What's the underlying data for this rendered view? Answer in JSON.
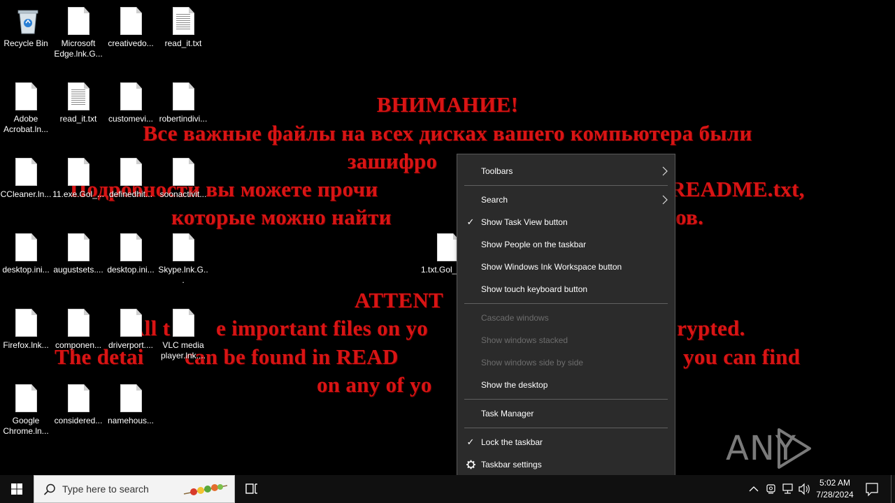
{
  "wallpaper": {
    "lines": [
      "ВНИМАНИЕ!",
      "Все важные файлы на всех дисках вашего компьютера были",
      "зашифро",
      "Подробности вы можете прочи",
      "README.txt,",
      "которые можно найти",
      "ов.",
      "ATTENT",
      "All t",
      "e important files on yo",
      "rypted.",
      "The detai",
      "can be found in READ",
      "you can find",
      "on any of yo"
    ]
  },
  "desktop_icons": [
    {
      "label": "Recycle Bin",
      "icon": "recycle-bin-icon"
    },
    {
      "label": "Microsoft Edge.lnk.G...",
      "icon": "file-icon"
    },
    {
      "label": "creativedo...",
      "icon": "file-icon"
    },
    {
      "label": "read_it.txt",
      "icon": "text-file-icon"
    },
    {
      "label": "Adobe Acrobat.ln...",
      "icon": "file-icon"
    },
    {
      "label": "read_it.txt",
      "icon": "text-file-icon"
    },
    {
      "label": "customevi...",
      "icon": "file-icon"
    },
    {
      "label": "robertindivi...",
      "icon": "file-icon"
    },
    {
      "label": "CCleaner.ln...",
      "icon": "file-icon"
    },
    {
      "label": "11.exe.Gol_...",
      "icon": "file-icon"
    },
    {
      "label": "definedhit...",
      "icon": "file-icon"
    },
    {
      "label": "soonactivit...",
      "icon": "file-icon"
    },
    {
      "label": "desktop.ini...",
      "icon": "file-icon"
    },
    {
      "label": "augustsets....",
      "icon": "file-icon"
    },
    {
      "label": "desktop.ini...",
      "icon": "file-icon"
    },
    {
      "label": "Skype.lnk.G...",
      "icon": "file-icon"
    },
    {
      "label": "Firefox.lnk...",
      "icon": "file-icon"
    },
    {
      "label": "componen...",
      "icon": "file-icon"
    },
    {
      "label": "driverport....",
      "icon": "file-icon"
    },
    {
      "label": "VLC media player.lnk....",
      "icon": "file-icon"
    },
    {
      "label": "Google Chrome.ln...",
      "icon": "file-icon"
    },
    {
      "label": "considered...",
      "icon": "file-icon"
    },
    {
      "label": "namehous...",
      "icon": "file-icon"
    },
    {
      "label": "1.txt.Gol_",
      "icon": "file-icon"
    }
  ],
  "context_menu": {
    "toolbars": "Toolbars",
    "search": "Search",
    "show_task_view": "Show Task View button",
    "show_people": "Show People on the taskbar",
    "show_ink": "Show Windows Ink Workspace button",
    "show_touch_keyboard": "Show touch keyboard button",
    "cascade": "Cascade windows",
    "stacked": "Show windows stacked",
    "side_by_side": "Show windows side by side",
    "show_desktop": "Show the desktop",
    "task_manager": "Task Manager",
    "lock_taskbar": "Lock the taskbar",
    "taskbar_settings": "Taskbar settings",
    "check_glyph": "✓",
    "arrow_glyph": "›"
  },
  "watermark": {
    "text": "ANY  RUN"
  },
  "taskbar": {
    "search_placeholder": "Type here to search",
    "time": "5:02 AM",
    "date": "7/28/2024"
  }
}
